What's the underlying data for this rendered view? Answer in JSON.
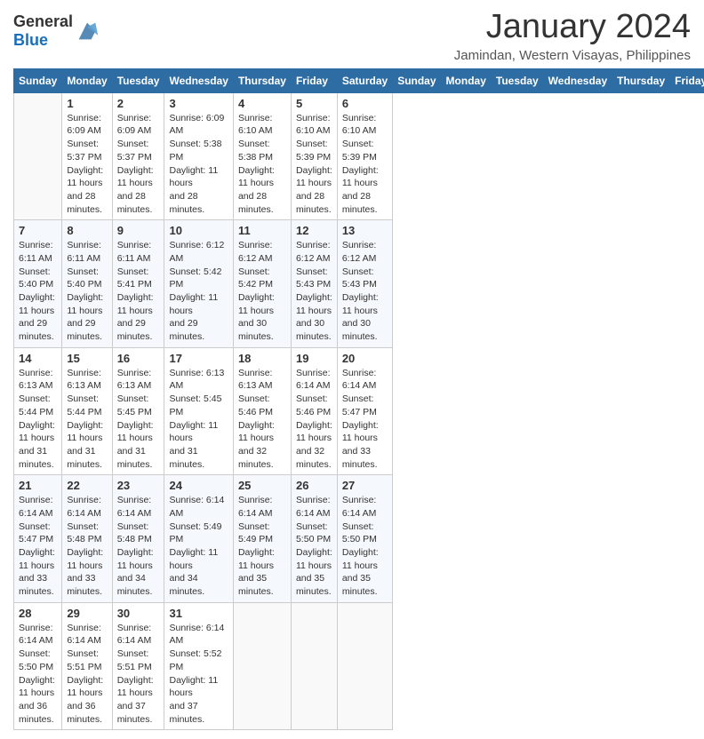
{
  "header": {
    "logo_general": "General",
    "logo_blue": "Blue",
    "month_title": "January 2024",
    "location": "Jamindan, Western Visayas, Philippines"
  },
  "days_of_week": [
    "Sunday",
    "Monday",
    "Tuesday",
    "Wednesday",
    "Thursday",
    "Friday",
    "Saturday"
  ],
  "weeks": [
    [
      {
        "day": "",
        "info": ""
      },
      {
        "day": "1",
        "info": "Sunrise: 6:09 AM\nSunset: 5:37 PM\nDaylight: 11 hours\nand 28 minutes."
      },
      {
        "day": "2",
        "info": "Sunrise: 6:09 AM\nSunset: 5:37 PM\nDaylight: 11 hours\nand 28 minutes."
      },
      {
        "day": "3",
        "info": "Sunrise: 6:09 AM\nSunset: 5:38 PM\nDaylight: 11 hours\nand 28 minutes."
      },
      {
        "day": "4",
        "info": "Sunrise: 6:10 AM\nSunset: 5:38 PM\nDaylight: 11 hours\nand 28 minutes."
      },
      {
        "day": "5",
        "info": "Sunrise: 6:10 AM\nSunset: 5:39 PM\nDaylight: 11 hours\nand 28 minutes."
      },
      {
        "day": "6",
        "info": "Sunrise: 6:10 AM\nSunset: 5:39 PM\nDaylight: 11 hours\nand 28 minutes."
      }
    ],
    [
      {
        "day": "7",
        "info": "Sunrise: 6:11 AM\nSunset: 5:40 PM\nDaylight: 11 hours\nand 29 minutes."
      },
      {
        "day": "8",
        "info": "Sunrise: 6:11 AM\nSunset: 5:40 PM\nDaylight: 11 hours\nand 29 minutes."
      },
      {
        "day": "9",
        "info": "Sunrise: 6:11 AM\nSunset: 5:41 PM\nDaylight: 11 hours\nand 29 minutes."
      },
      {
        "day": "10",
        "info": "Sunrise: 6:12 AM\nSunset: 5:42 PM\nDaylight: 11 hours\nand 29 minutes."
      },
      {
        "day": "11",
        "info": "Sunrise: 6:12 AM\nSunset: 5:42 PM\nDaylight: 11 hours\nand 30 minutes."
      },
      {
        "day": "12",
        "info": "Sunrise: 6:12 AM\nSunset: 5:43 PM\nDaylight: 11 hours\nand 30 minutes."
      },
      {
        "day": "13",
        "info": "Sunrise: 6:12 AM\nSunset: 5:43 PM\nDaylight: 11 hours\nand 30 minutes."
      }
    ],
    [
      {
        "day": "14",
        "info": "Sunrise: 6:13 AM\nSunset: 5:44 PM\nDaylight: 11 hours\nand 31 minutes."
      },
      {
        "day": "15",
        "info": "Sunrise: 6:13 AM\nSunset: 5:44 PM\nDaylight: 11 hours\nand 31 minutes."
      },
      {
        "day": "16",
        "info": "Sunrise: 6:13 AM\nSunset: 5:45 PM\nDaylight: 11 hours\nand 31 minutes."
      },
      {
        "day": "17",
        "info": "Sunrise: 6:13 AM\nSunset: 5:45 PM\nDaylight: 11 hours\nand 31 minutes."
      },
      {
        "day": "18",
        "info": "Sunrise: 6:13 AM\nSunset: 5:46 PM\nDaylight: 11 hours\nand 32 minutes."
      },
      {
        "day": "19",
        "info": "Sunrise: 6:14 AM\nSunset: 5:46 PM\nDaylight: 11 hours\nand 32 minutes."
      },
      {
        "day": "20",
        "info": "Sunrise: 6:14 AM\nSunset: 5:47 PM\nDaylight: 11 hours\nand 33 minutes."
      }
    ],
    [
      {
        "day": "21",
        "info": "Sunrise: 6:14 AM\nSunset: 5:47 PM\nDaylight: 11 hours\nand 33 minutes."
      },
      {
        "day": "22",
        "info": "Sunrise: 6:14 AM\nSunset: 5:48 PM\nDaylight: 11 hours\nand 33 minutes."
      },
      {
        "day": "23",
        "info": "Sunrise: 6:14 AM\nSunset: 5:48 PM\nDaylight: 11 hours\nand 34 minutes."
      },
      {
        "day": "24",
        "info": "Sunrise: 6:14 AM\nSunset: 5:49 PM\nDaylight: 11 hours\nand 34 minutes."
      },
      {
        "day": "25",
        "info": "Sunrise: 6:14 AM\nSunset: 5:49 PM\nDaylight: 11 hours\nand 35 minutes."
      },
      {
        "day": "26",
        "info": "Sunrise: 6:14 AM\nSunset: 5:50 PM\nDaylight: 11 hours\nand 35 minutes."
      },
      {
        "day": "27",
        "info": "Sunrise: 6:14 AM\nSunset: 5:50 PM\nDaylight: 11 hours\nand 35 minutes."
      }
    ],
    [
      {
        "day": "28",
        "info": "Sunrise: 6:14 AM\nSunset: 5:50 PM\nDaylight: 11 hours\nand 36 minutes."
      },
      {
        "day": "29",
        "info": "Sunrise: 6:14 AM\nSunset: 5:51 PM\nDaylight: 11 hours\nand 36 minutes."
      },
      {
        "day": "30",
        "info": "Sunrise: 6:14 AM\nSunset: 5:51 PM\nDaylight: 11 hours\nand 37 minutes."
      },
      {
        "day": "31",
        "info": "Sunrise: 6:14 AM\nSunset: 5:52 PM\nDaylight: 11 hours\nand 37 minutes."
      },
      {
        "day": "",
        "info": ""
      },
      {
        "day": "",
        "info": ""
      },
      {
        "day": "",
        "info": ""
      }
    ]
  ]
}
